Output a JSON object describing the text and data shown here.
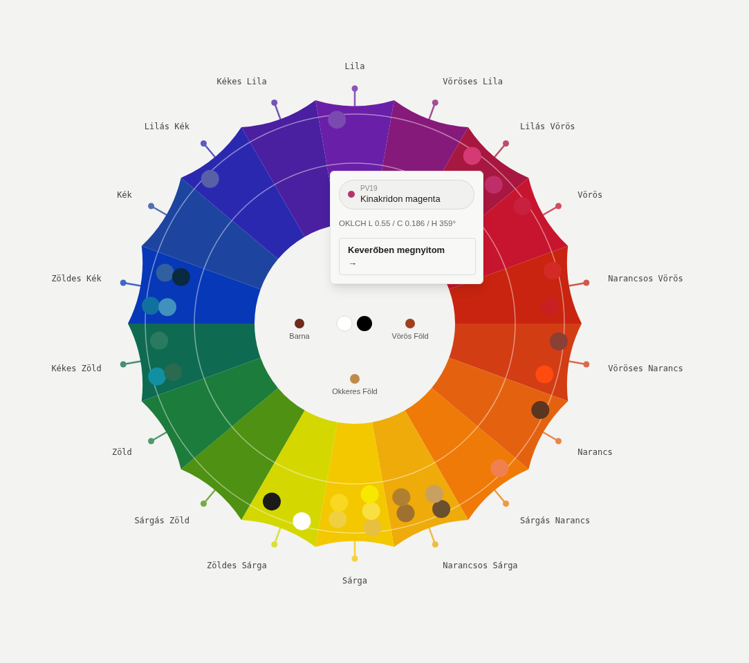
{
  "hues": [
    {
      "label": "Lila",
      "color": "#6a1fa8",
      "swatches": [
        {
          "color": "#7a4ab0"
        }
      ]
    },
    {
      "label": "Vöröses Lila",
      "color": "#861a7a"
    },
    {
      "label": "Lilás Vörös",
      "color": "#a8173f",
      "swatches": [
        {
          "color": "#d63a74"
        },
        {
          "color": "#c02e6a"
        }
      ]
    },
    {
      "label": "Vörös",
      "color": "#c8152f",
      "swatches": [
        {
          "color": "#c8203e"
        }
      ]
    },
    {
      "label": "Narancsos Vörös",
      "color": "#c8240f",
      "swatches": [
        {
          "color": "#d42a25"
        },
        {
          "color": "#c82020"
        }
      ]
    },
    {
      "label": "Vöröses Narancs",
      "color": "#d23d14",
      "swatches": [
        {
          "color": "#8a4035"
        },
        {
          "color": "#ff4a10"
        }
      ]
    },
    {
      "label": "Narancs",
      "color": "#e4620f",
      "swatches": [
        {
          "color": "#5a3520"
        }
      ]
    },
    {
      "label": "Sárgás Narancs",
      "color": "#ef7a07",
      "swatches": [
        {
          "color": "#f08050"
        }
      ]
    },
    {
      "label": "Narancsos Sárga",
      "color": "#eeab0a",
      "swatches": [
        {
          "color": "#6b5030"
        },
        {
          "color": "#a07030"
        },
        {
          "color": "#c8a060"
        },
        {
          "color": "#b08030"
        }
      ]
    },
    {
      "label": "Sárga",
      "color": "#f3c800",
      "swatches": [
        {
          "color": "#e8c040"
        },
        {
          "color": "#f0d040"
        },
        {
          "color": "#f8e040"
        },
        {
          "color": "#f8d820"
        },
        {
          "color": "#f8e800"
        }
      ]
    },
    {
      "label": "Zöldes Sárga",
      "color": "#d4d800",
      "swatches": [
        {
          "color": "#ffffff"
        },
        {
          "color": "#1a1a1a"
        }
      ]
    },
    {
      "label": "Sárgás Zöld",
      "color": "#4f9112"
    },
    {
      "label": "Zöld",
      "color": "#1c7c3c"
    },
    {
      "label": "Kékes Zöld",
      "color": "#0f6a52",
      "swatches": [
        {
          "color": "#1090a0"
        },
        {
          "color": "#2a7a60"
        },
        {
          "color": "#2a6a50"
        }
      ]
    },
    {
      "label": "Zöldes Kék",
      "color": "#0738b8",
      "swatches": [
        {
          "color": "#1070a0"
        },
        {
          "color": "#3060a0"
        },
        {
          "color": "#4090c0"
        },
        {
          "color": "#0a2a40"
        }
      ]
    },
    {
      "label": "Kék",
      "color": "#1d45a0"
    },
    {
      "label": "Lilás Kék",
      "color": "#2b28b0",
      "swatches": [
        {
          "color": "#5a60a8"
        }
      ]
    },
    {
      "label": "Kékes Lila",
      "color": "#4a1fa0"
    }
  ],
  "neutrals": [
    {
      "label": "Barna",
      "color": "#6e2a1e"
    },
    {
      "color": "#ffffff"
    },
    {
      "color": "#000000"
    },
    {
      "label": "Vörös Föld",
      "color": "#a0401f"
    },
    {
      "label": "Okkeres Föld",
      "color": "#c08a48"
    }
  ],
  "popup": {
    "code": "PV19",
    "name": "Kinakridon magenta",
    "color": "#b8336a",
    "oklch": "OKLCH L 0.55 / C 0.186 / H 359°",
    "button": "Keverőben megnyitom →"
  }
}
